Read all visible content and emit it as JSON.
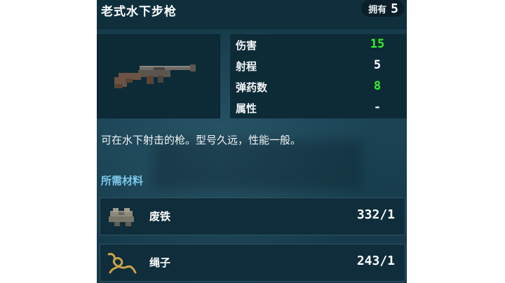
{
  "item": {
    "title": "老式水下步枪",
    "owned_label": "拥有",
    "owned_count": "5",
    "icon": "rifle-icon"
  },
  "stats": [
    {
      "label": "伤害",
      "value": "15",
      "color": "#38f02a"
    },
    {
      "label": "射程",
      "value": "5",
      "color": "#ffffff"
    },
    {
      "label": "弹药数",
      "value": "8",
      "color": "#38f02a"
    },
    {
      "label": "属性",
      "value": "-",
      "color": "#ffffff"
    }
  ],
  "description": "可在水下射击的枪。型号久远，性能一般。",
  "materials": {
    "heading": "所需材料",
    "items": [
      {
        "name": "废铁",
        "count": "332/1",
        "icon": "scrap-iron-icon"
      },
      {
        "name": "绳子",
        "count": "243/1",
        "icon": "rope-icon"
      }
    ]
  }
}
